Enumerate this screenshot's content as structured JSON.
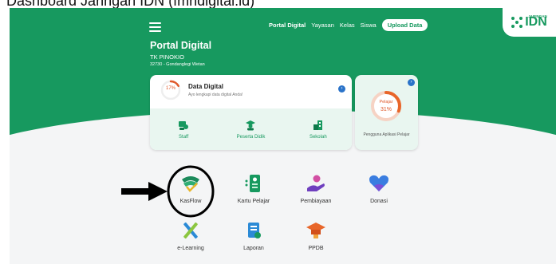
{
  "caption": "Dashboard Jaringan IDN (fmhdigital.id)",
  "header": {
    "nav": [
      "Portal Digital",
      "Yayasan",
      "Kelas",
      "Siswa"
    ],
    "upload_label": "Upload Data",
    "brand_text": "IDN",
    "brand_small": "JARINGAN",
    "brand_color": "#17995f"
  },
  "portal": {
    "title": "Portal Digital",
    "school": "TK PINOKIO",
    "location": "32730 - Gondanglegi Wetan"
  },
  "data_digital": {
    "percent_label": "17%",
    "percent": 17,
    "title": "Data Digital",
    "subtitle": "Ayo lengkapi data digital Anda!",
    "items": [
      {
        "label": "Staff",
        "icon": "staff-icon"
      },
      {
        "label": "Peserta Didik",
        "icon": "student-icon"
      },
      {
        "label": "Sekolah",
        "icon": "school-icon"
      }
    ]
  },
  "pelajar_card": {
    "label": "Pelajar",
    "percent_label": "31%",
    "percent": 31,
    "caption": "Pengguna Aplikasi Pelajar"
  },
  "apps": [
    {
      "label": "KasFlow",
      "icon": "kasflow-icon"
    },
    {
      "label": "Kartu Pelajar",
      "icon": "student-card-icon"
    },
    {
      "label": "Pembiayaan",
      "icon": "financing-icon"
    },
    {
      "label": "Donasi",
      "icon": "donation-heart-icon"
    },
    {
      "label": "e-Learning",
      "icon": "elearning-icon"
    },
    {
      "label": "Laporan",
      "icon": "report-icon"
    },
    {
      "label": "PPDB",
      "icon": "graduation-cap-icon"
    }
  ]
}
